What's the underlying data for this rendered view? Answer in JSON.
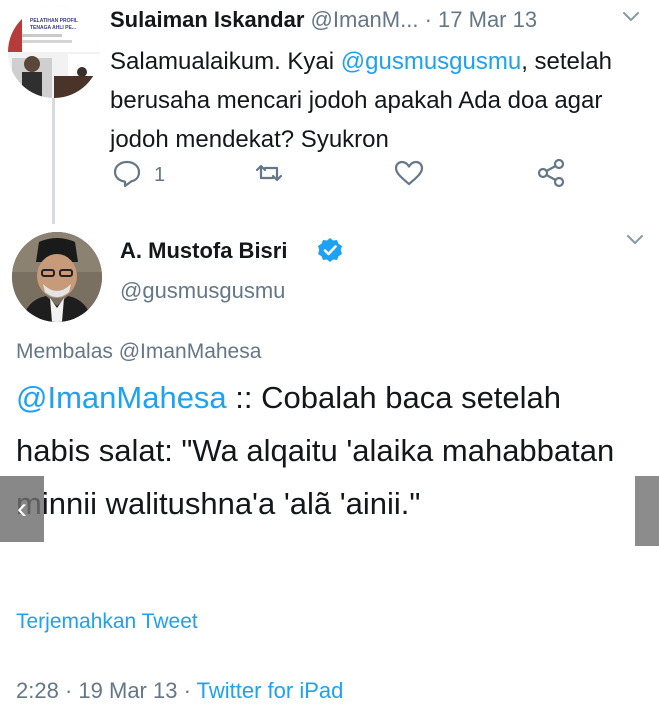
{
  "reply_tweet": {
    "name": "Sulaiman Iskandar",
    "handle": "@ImanM...",
    "separator": "·",
    "date": "17 Mar 13",
    "text_before": "Salamualaikum. Kyai ",
    "mention": "@gusmusgusmu",
    "text_after": ", setelah berusaha mencari jodoh apakah Ada doa agar jodoh mendekat? Syukron",
    "reply_count": "1",
    "avatar_banner_text": "PELATIHAN PROFIL TENAGA AHLI PE..."
  },
  "main_tweet": {
    "name": "A. Mustofa Bisri",
    "handle": "@gusmusgusmu",
    "replying_to": "Membalas @ImanMahesa",
    "mention": "@ImanMahesa",
    "text": " :: Cobalah baca setelah habis salat: \"Wa alqaitu 'alaika mahabbatan minnii walitushna'a 'alã 'ainii.\"",
    "translate_link": "Terjemahkan Tweet",
    "time": "2:28",
    "separator": "·",
    "date": "19 Mar 13",
    "source": "Twitter for iPad"
  },
  "overlay": {
    "prev_arrow": "‹"
  },
  "icons": {
    "reply": "reply-icon",
    "retweet": "retweet-icon",
    "like": "heart-icon",
    "share": "share-icon",
    "verified": "verified-badge-icon",
    "chevron": "chevron-down-icon"
  },
  "colors": {
    "link": "#1da1f2",
    "secondary_text": "#657786",
    "primary_text": "#14171a",
    "thread_line": "#d6dbe0"
  }
}
